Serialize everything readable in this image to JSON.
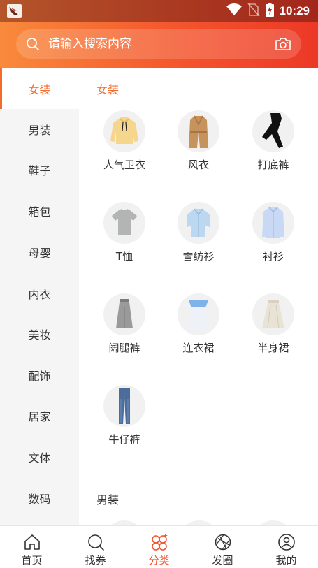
{
  "status_bar": {
    "time": "10:29",
    "icons": [
      "app-logo-icon",
      "wifi-icon",
      "no-sim-icon",
      "battery-charging-icon"
    ]
  },
  "search": {
    "placeholder": "请输入搜索内容",
    "value": "",
    "icons": [
      "search-icon",
      "camera-icon"
    ]
  },
  "sidebar": {
    "active_index": 0,
    "items": [
      {
        "label": "女装"
      },
      {
        "label": "男装"
      },
      {
        "label": "鞋子"
      },
      {
        "label": "箱包"
      },
      {
        "label": "母婴"
      },
      {
        "label": "内衣"
      },
      {
        "label": "美妆"
      },
      {
        "label": "配饰"
      },
      {
        "label": "居家"
      },
      {
        "label": "文体"
      },
      {
        "label": "数码"
      }
    ]
  },
  "content": {
    "sections": [
      {
        "title": "女装",
        "items": [
          {
            "label": "人气卫衣",
            "icon": "hoodie-icon"
          },
          {
            "label": "风衣",
            "icon": "trench-coat-icon"
          },
          {
            "label": "打底裤",
            "icon": "leggings-icon"
          },
          {
            "label": "T恤",
            "icon": "tshirt-icon"
          },
          {
            "label": "雪纺衫",
            "icon": "chiffon-blouse-icon"
          },
          {
            "label": "衬衫",
            "icon": "shirt-icon"
          },
          {
            "label": "阔腿裤",
            "icon": "wide-leg-pants-icon"
          },
          {
            "label": "连衣裙",
            "icon": "dress-icon"
          },
          {
            "label": "半身裙",
            "icon": "skirt-icon"
          },
          {
            "label": "牛仔裤",
            "icon": "jeans-icon"
          }
        ]
      },
      {
        "title": "男装",
        "items": []
      }
    ]
  },
  "bottom_nav": {
    "active_index": 2,
    "items": [
      {
        "label": "首页",
        "icon": "home-icon"
      },
      {
        "label": "找券",
        "icon": "search-coupon-icon"
      },
      {
        "label": "分类",
        "icon": "category-icon"
      },
      {
        "label": "发圈",
        "icon": "aperture-icon"
      },
      {
        "label": "我的",
        "icon": "user-icon"
      }
    ]
  },
  "colors": {
    "accent": "#f46b2c",
    "header_gradient": [
      "#f98a3c",
      "#ec3826"
    ],
    "nav_active": "#f4502d"
  }
}
